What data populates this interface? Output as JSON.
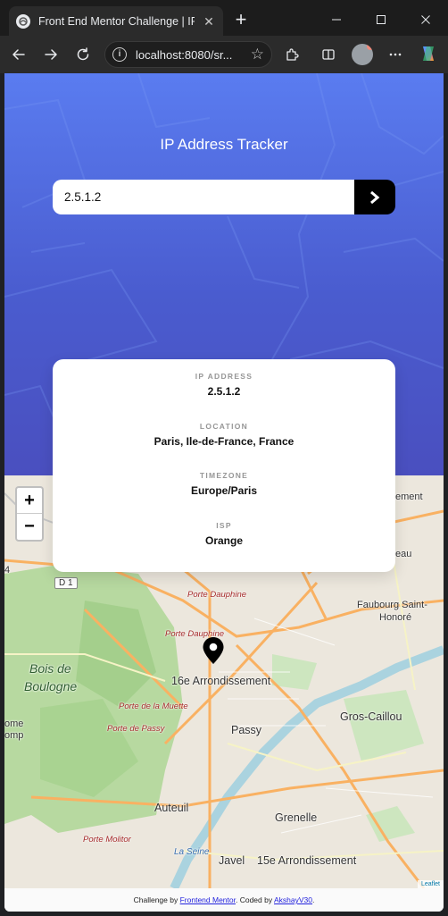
{
  "browser": {
    "tab_title": "Front End Mentor Challenge | IP A",
    "url": "localhost:8080/sr...",
    "new_tab_symbol": "+",
    "icons": [
      "favicon-icon",
      "close-icon",
      "minimize-icon",
      "maximize-icon",
      "window-close-icon",
      "back-icon",
      "forward-icon",
      "refresh-icon",
      "info-icon",
      "star-icon",
      "extensions-icon",
      "split-screen-icon",
      "profile-avatar",
      "more-icon",
      "copilot-icon"
    ]
  },
  "header": {
    "title": "IP Address Tracker"
  },
  "search": {
    "value": "2.5.1.2",
    "submit_icon": "chevron-right-icon"
  },
  "info": {
    "ip_label": "IP ADDRESS",
    "ip_value": "2.5.1.2",
    "location_label": "LOCATION",
    "location_value": "Paris, Ile-de-France, France",
    "timezone_label": "TIMEZONE",
    "timezone_value": "Europe/Paris",
    "isp_label": "ISP",
    "isp_value": "Orange"
  },
  "map": {
    "zoom_in": "+",
    "zoom_out": "−",
    "road_tag": "D 1",
    "labels": {
      "porte_dauphine_1": "Porte Dauphine",
      "porte_dauphine_2": "Porte Dauphine",
      "faubourg_1": "Faubourg Saint-",
      "faubourg_2": "Honoré",
      "bois_1": "Bois de",
      "bois_2": "Boulogne",
      "arrondissement_16": "16e Arrondissement",
      "porte_muette": "Porte de la Muette",
      "porte_passy": "Porte de Passy",
      "passy": "Passy",
      "gros_caillou": "Gros-Caillou",
      "auteuil": "Auteuil",
      "grenelle": "Grenelle",
      "porte_molitor": "Porte Molitor",
      "la_seine": "La Seine",
      "javel": "Javel",
      "arrondissement_15": "15e Arrondissement",
      "edge_ome": "ome",
      "edge_omp": "omp",
      "edge_ement": "ement",
      "edge_eau": "eau",
      "edge_4": "4"
    },
    "attribution": "Leaflet",
    "marker_icon": "location-pin-icon"
  },
  "footer": {
    "prefix": "Challenge by",
    "mentor_link": "Frontend Mentor",
    "middle": ". Coded by",
    "author_link": "AkshayV30",
    "suffix": "."
  },
  "colors": {
    "hero_top": "#5a7cf0",
    "hero_bottom": "#4a4fbf",
    "button": "#000000",
    "label_gray": "#969696"
  }
}
